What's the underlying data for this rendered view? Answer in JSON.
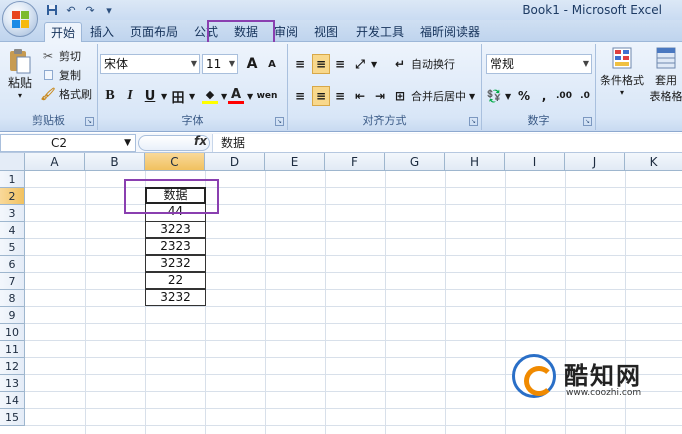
{
  "window": {
    "title": "Book1 - Microsoft Excel"
  },
  "qat": {
    "undo": "↶",
    "redo": "↷",
    "customize": "▾"
  },
  "tabs": [
    "开始",
    "插入",
    "页面布局",
    "公式",
    "数据",
    "审阅",
    "视图",
    "开发工具",
    "福昕阅读器"
  ],
  "ribbon": {
    "clipboard": {
      "paste": "粘贴",
      "cut": "剪切",
      "copy": "复制",
      "format_painter": "格式刷",
      "label": "剪贴板"
    },
    "font": {
      "name": "宋体",
      "size": "11",
      "grow": "A",
      "shrink": "A",
      "bold": "B",
      "italic": "I",
      "underline": "U",
      "border": "田",
      "fill": "A",
      "color": "A",
      "phonetic": "wen",
      "label": "字体"
    },
    "alignment": {
      "wrap": "自动换行",
      "merge": "合并后居中",
      "label": "对齐方式"
    },
    "number": {
      "format": "常规",
      "percent": "%",
      "comma": ",",
      "inc": ".00",
      "dec": ".0",
      "label": "数字"
    },
    "styles": {
      "cond": "条件格式",
      "table": "套用",
      "table2": "表格格"
    }
  },
  "formula_bar": {
    "name_box": "C2",
    "fx": "fx",
    "content": "数据"
  },
  "grid": {
    "columns": [
      "A",
      "B",
      "C",
      "D",
      "E",
      "F",
      "G",
      "H",
      "I",
      "J",
      "K"
    ],
    "rows": [
      "1",
      "2",
      "3",
      "4",
      "5",
      "6",
      "7",
      "8",
      "9",
      "10",
      "11",
      "12",
      "13",
      "14",
      "15"
    ],
    "cells": [
      "数据",
      "44",
      "3223",
      "2323",
      "3232",
      "22",
      "3232"
    ]
  },
  "watermark": {
    "name": "酷知网",
    "url": "www.coozhi.com"
  },
  "colors": {
    "highlight": "#8a3fb0",
    "accent": "#2a6fc7"
  }
}
